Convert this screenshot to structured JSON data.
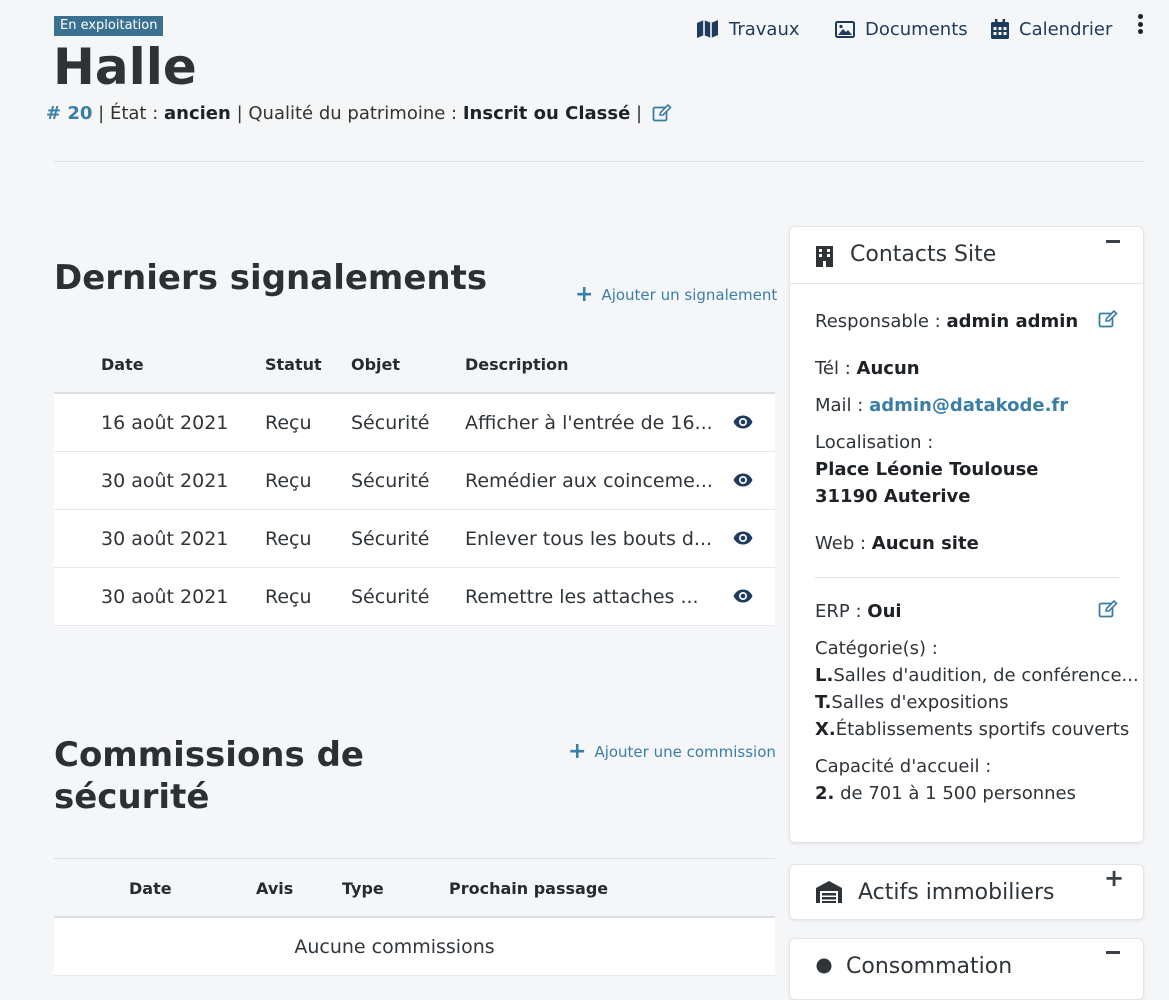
{
  "header": {
    "status_badge": "En exploitation",
    "title": "Halle",
    "number": "# 20",
    "etat_label": "État :",
    "etat_value": "ancien",
    "qualite_label": "Qualité du patrimoine :",
    "qualite_value": "Inscrit ou Classé",
    "separator": "|"
  },
  "topnav": {
    "travaux": "Travaux",
    "documents": "Documents",
    "calendrier": "Calendrier"
  },
  "signalements": {
    "title": "Derniers signalements",
    "add_label": "Ajouter un signalement",
    "columns": [
      "Date",
      "Statut",
      "Objet",
      "Description"
    ],
    "rows": [
      {
        "date": "16 août 2021",
        "statut": "Reçu",
        "objet": "Sécurité",
        "description": "Afficher à l'entrée de 16..."
      },
      {
        "date": "30 août 2021",
        "statut": "Reçu",
        "objet": "Sécurité",
        "description": "Remédier aux coinceme..."
      },
      {
        "date": "30 août 2021",
        "statut": "Reçu",
        "objet": "Sécurité",
        "description": "Enlever tous les bouts d..."
      },
      {
        "date": "30 août 2021",
        "statut": "Reçu",
        "objet": "Sécurité",
        "description": "Remettre les attaches ..."
      }
    ]
  },
  "commissions": {
    "title_line1": "Commissions de",
    "title_line2": "sécurité",
    "add_label": "Ajouter une commission",
    "columns": [
      "Date",
      "Avis",
      "Type",
      "Prochain passage"
    ],
    "empty_text": "Aucune commissions"
  },
  "contacts": {
    "title": "Contacts Site",
    "responsable_label": "Responsable :",
    "responsable_value": "admin admin",
    "tel_label": "Tél :",
    "tel_value": "Aucun",
    "mail_label": "Mail :",
    "mail_value": "admin@datakode.fr",
    "localisation_label": "Localisation :",
    "address_line1": "Place Léonie Toulouse",
    "address_line2": "31190 Auterive",
    "web_label": "Web :",
    "web_value": "Aucun site",
    "erp_label": "ERP :",
    "erp_value": "Oui",
    "categories_label": "Catégorie(s) :",
    "categories": [
      {
        "code": "L.",
        "label": "Salles d'audition, de conférence..."
      },
      {
        "code": "T.",
        "label": "Salles d'expositions"
      },
      {
        "code": "X.",
        "label": "Établissements sportifs couverts"
      }
    ],
    "capacite_label": "Capacité d'accueil :",
    "capacite_code": "2.",
    "capacite_value": "de 701 à 1 500 personnes"
  },
  "actifs": {
    "title": "Actifs immobiliers"
  },
  "consommation": {
    "title": "Consommation"
  },
  "colors": {
    "accent": "#3a7ea8",
    "badge": "#3a7191",
    "nav": "#1e3a5c"
  }
}
